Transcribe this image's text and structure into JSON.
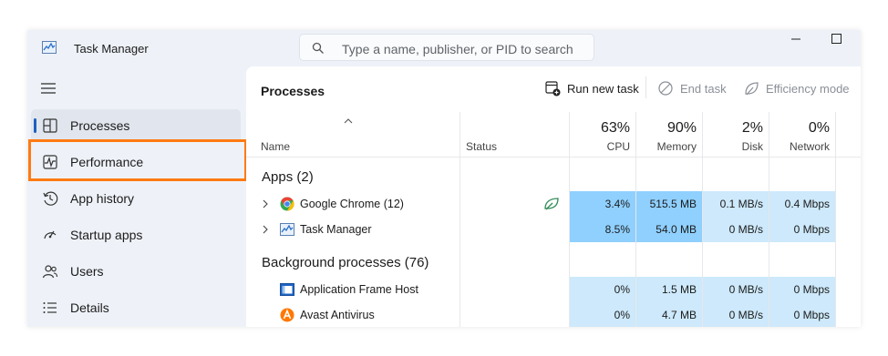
{
  "window": {
    "title": "Task Manager",
    "search_placeholder": "Type a name, publisher, or PID to search"
  },
  "sidebar": {
    "items": [
      {
        "label": "Processes",
        "icon": "processes-icon",
        "active": true
      },
      {
        "label": "Performance",
        "icon": "performance-icon",
        "active": false
      },
      {
        "label": "App history",
        "icon": "app-history-icon",
        "active": false
      },
      {
        "label": "Startup apps",
        "icon": "startup-apps-icon",
        "active": false
      },
      {
        "label": "Users",
        "icon": "users-icon",
        "active": false
      },
      {
        "label": "Details",
        "icon": "details-icon",
        "active": false
      }
    ],
    "highlight_color": "#ff7a12"
  },
  "toolbar": {
    "title": "Processes",
    "run_new_task": "Run new task",
    "end_task": "End task",
    "efficiency_mode": "Efficiency mode"
  },
  "table": {
    "headers": {
      "name": "Name",
      "status": "Status",
      "cpu_pct": "63%",
      "cpu": "CPU",
      "memory_pct": "90%",
      "memory": "Memory",
      "disk_pct": "2%",
      "disk": "Disk",
      "network_pct": "0%",
      "network": "Network"
    },
    "groups": {
      "apps": "Apps (2)",
      "background": "Background processes (76)"
    },
    "rows": [
      {
        "name": "Google Chrome (12)",
        "cpu": "3.4%",
        "memory": "515.5 MB",
        "disk": "0.1 MB/s",
        "network": "0.4 Mbps",
        "expandable": true,
        "efficiency": true
      },
      {
        "name": "Task Manager",
        "cpu": "8.5%",
        "memory": "54.0 MB",
        "disk": "0 MB/s",
        "network": "0 Mbps",
        "expandable": true,
        "efficiency": false
      },
      {
        "name": "Application Frame Host",
        "cpu": "0%",
        "memory": "1.5 MB",
        "disk": "0 MB/s",
        "network": "0 Mbps",
        "expandable": false,
        "efficiency": false
      },
      {
        "name": "Avast Antivirus",
        "cpu": "0%",
        "memory": "4.7 MB",
        "disk": "0 MB/s",
        "network": "0 Mbps",
        "expandable": false,
        "efficiency": false
      }
    ]
  },
  "colors": {
    "accent": "#1f5fbf",
    "heat_high": "#8fd0ff",
    "heat_low": "#cde9fb"
  }
}
